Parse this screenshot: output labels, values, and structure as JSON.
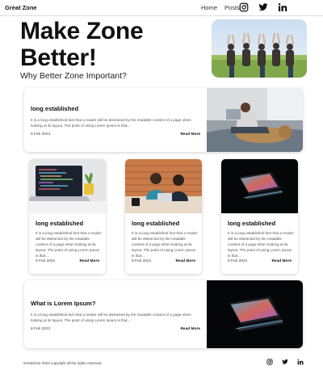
{
  "header": {
    "brand": "Great Zone",
    "nav": [
      "Home",
      "Posts"
    ],
    "social_icons": [
      "instagram-icon",
      "twitter-icon",
      "linkedin-icon"
    ]
  },
  "hero": {
    "title": "Make Zone Better!",
    "subtitle": "Why Better Zone Important?",
    "image": "group-of-friends-heart-hands-photo"
  },
  "featured": {
    "title": "long established",
    "excerpt": "It is a long established fact that a reader will be distracted by the readable content of a page when looking at its layout. The point of using Lorem Ipsum is that....",
    "date": "8 Feb 2022",
    "more": "Read More",
    "image": "woman-with-laptop-and-dog-photo"
  },
  "cards": [
    {
      "title": "long established",
      "excerpt": "It is a long established fact that a reader will be distracted by the readable content of a page when looking at its layout. The point of using Lorem Ipsum is that....",
      "date": "8 Feb 2022",
      "more": "Read More",
      "image": "laptop-code-photo"
    },
    {
      "title": "long established",
      "excerpt": "It is a long established fact that a reader will be distracted by the readable content of a page when looking at its layout. The point of using Lorem Ipsum is that....",
      "date": "8 Feb 2022",
      "more": "Read More",
      "image": "two-women-laptop-photo"
    },
    {
      "title": "long established",
      "excerpt": "It is a long established fact that a reader will be distracted by the readable content of a page when looking at its layout. The point of using Lorem Ipsum is that....",
      "date": "8 Feb 2022",
      "more": "Read More",
      "image": "glowing-laptop-dark-photo"
    }
  ],
  "bottom": {
    "title": "What is Lorem Ipsum?",
    "excerpt": "It is a long established fact that a reader will be distracted by the readable content of a page when looking at its layout. The point of using Lorem Ipsum is that....",
    "date": "8 Feb 2022",
    "more": "Read More",
    "image": "glowing-laptop-dark-photo"
  },
  "footer": {
    "copyright": "GreatZone 2023 copyright all the rights reserved"
  }
}
